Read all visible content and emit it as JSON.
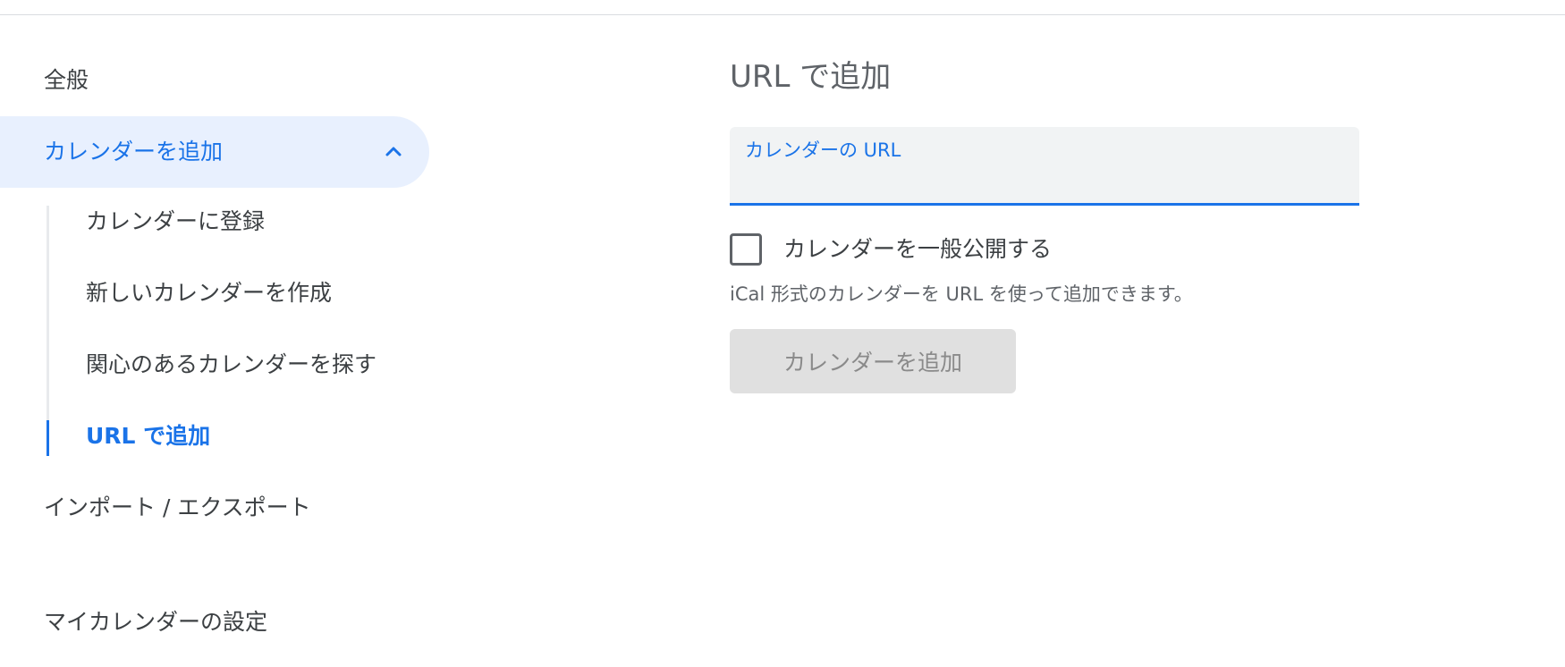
{
  "sidebar": {
    "general": "全般",
    "add_calendar": "カレンダーを追加",
    "sub_items": [
      "カレンダーに登録",
      "新しいカレンダーを作成",
      "関心のあるカレンダーを探す",
      "URL で追加"
    ],
    "import_export": "インポート / エクスポート",
    "my_calendars_settings": "マイカレンダーの設定"
  },
  "main": {
    "title": "URL で追加",
    "url_field": {
      "label": "カレンダーの URL",
      "value": ""
    },
    "public_checkbox": {
      "label": "カレンダーを一般公開する",
      "checked": false
    },
    "helper_text": "iCal 形式のカレンダーを URL を使って追加できます。",
    "add_button": "カレンダーを追加"
  },
  "colors": {
    "accent": "#1a73e8",
    "selected_bg": "#e8f0fe",
    "button_disabled_bg": "#e0e0e0"
  },
  "icons": {
    "collapse": "chevron-up-icon"
  }
}
